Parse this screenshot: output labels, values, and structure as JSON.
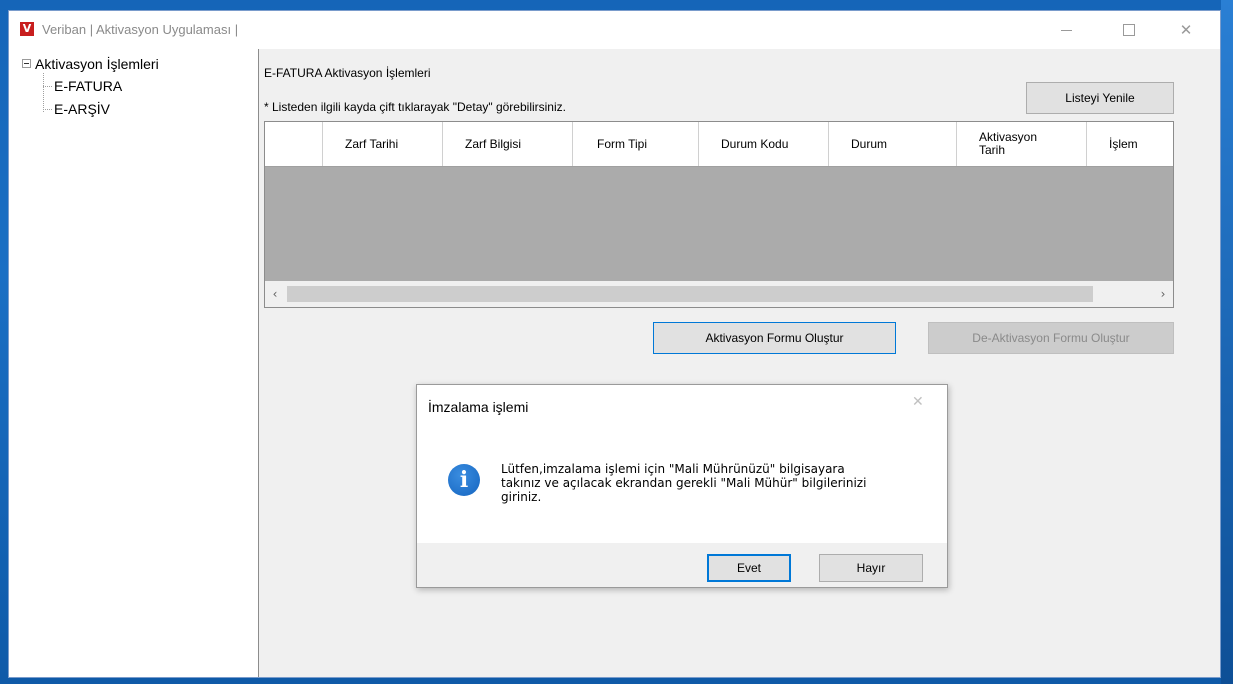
{
  "window": {
    "title": "Veriban | Aktivasyon Uygulaması |",
    "logo_letter": "V",
    "min_label": "",
    "max_label": "",
    "close_label": "✕"
  },
  "tree": {
    "root_label": "Aktivasyon İşlemleri",
    "items": [
      {
        "label": "E-FATURA"
      },
      {
        "label": "E-ARŞİV"
      }
    ]
  },
  "main": {
    "section_title": "E-FATURA Aktivasyon İşlemleri",
    "hint": "* Listeden ilgili kayda çift tıklarayak \"Detay\" görebilirsiniz.",
    "refresh_button": "Listeyi Yenile",
    "activate_button": "Aktivasyon Formu Oluştur",
    "deactivate_button": "De-Aktivasyon Formu Oluştur"
  },
  "grid": {
    "columns": [
      "",
      "Zarf Tarihi",
      "Zarf Bilgisi",
      "Form Tipi",
      "Durum Kodu",
      "Durum",
      "Aktivasyon Tarih",
      "İşlem"
    ],
    "scroll_left": "‹",
    "scroll_right": "›"
  },
  "dialog": {
    "title": "İmzalama işlemi",
    "close": "✕",
    "icon_glyph": "i",
    "message_line1": "Lütfen,imzalama işlemi için \"Mali Mührünüzü\" bilgisayara",
    "message_line2": "takınız ve açılacak ekrandan gerekli  \"Mali Mühür\" bilgilerinizi",
    "message_line3": "giriniz.",
    "yes_button": "Evet",
    "no_button": "Hayır"
  }
}
